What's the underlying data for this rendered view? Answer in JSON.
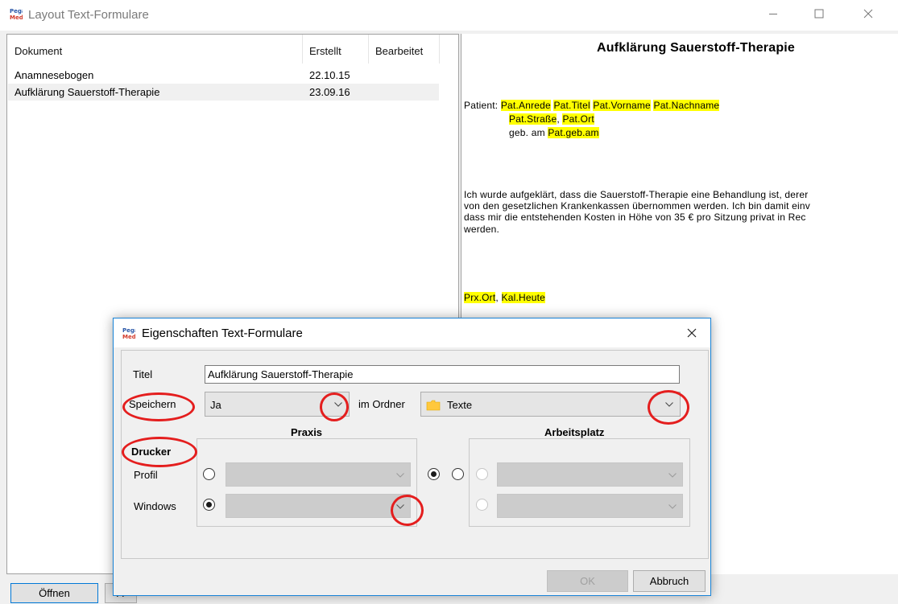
{
  "window": {
    "title": "Layout Text-Formulare",
    "logo_text": "Pega Med"
  },
  "document_list": {
    "columns": [
      "Dokument",
      "Erstellt",
      "Bearbeitet"
    ],
    "rows": [
      {
        "dokument": "Anamnesebogen",
        "erstellt": "22.10.15",
        "bearbeitet": ""
      },
      {
        "dokument": "Aufklärung Sauerstoff-Therapie",
        "erstellt": "23.09.16",
        "bearbeitet": ""
      }
    ],
    "selected_index": 1
  },
  "preview": {
    "title": "Aufklärung Sauerstoff-Therapie",
    "patient_label": "Patient:",
    "field_anrede": "Pat.Anrede",
    "field_titel": "Pat.Titel",
    "field_vorname": "Pat.Vorname",
    "field_nachname": "Pat.Nachname",
    "field_strasse": "Pat.Straße",
    "comma": ",",
    "field_ort": "Pat.Ort",
    "geb_label": "geb. am",
    "field_gebam": "Pat.geb.am",
    "body_line1": "Ich wurde aufgeklärt, dass die Sauerstoff-Therapie eine Behandlung ist, derer",
    "body_line2": "von den gesetzlichen Krankenkassen übernommen werden. Ich bin damit einv",
    "body_line3": "dass mir die entstehenden Kosten in Höhe von 35 € pro Sitzung privat in Rec",
    "body_line4": "werden.",
    "field_prx_ort": "Prx.Ort",
    "field_kal_heute": "Kal.Heute"
  },
  "bottom_buttons": {
    "open_label": "Öffnen",
    "second_label": "A"
  },
  "dialog": {
    "title": "Eigenschaften Text-Formulare",
    "titel_label": "Titel",
    "titel_value": "Aufklärung Sauerstoff-Therapie",
    "speichern_label": "Speichern",
    "speichern_value": "Ja",
    "ordner_label": "im Ordner",
    "ordner_value": "Texte",
    "drucker_label": "Drucker",
    "praxis_label": "Praxis",
    "arbeitsplatz_label": "Arbeitsplatz",
    "profil_label": "Profil",
    "windows_label": "Windows",
    "ok_label": "OK",
    "cancel_label": "Abbruch"
  },
  "colors": {
    "highlight": "#ffff00",
    "annotation": "#e41e1e",
    "dialog_border": "#1883d7"
  }
}
